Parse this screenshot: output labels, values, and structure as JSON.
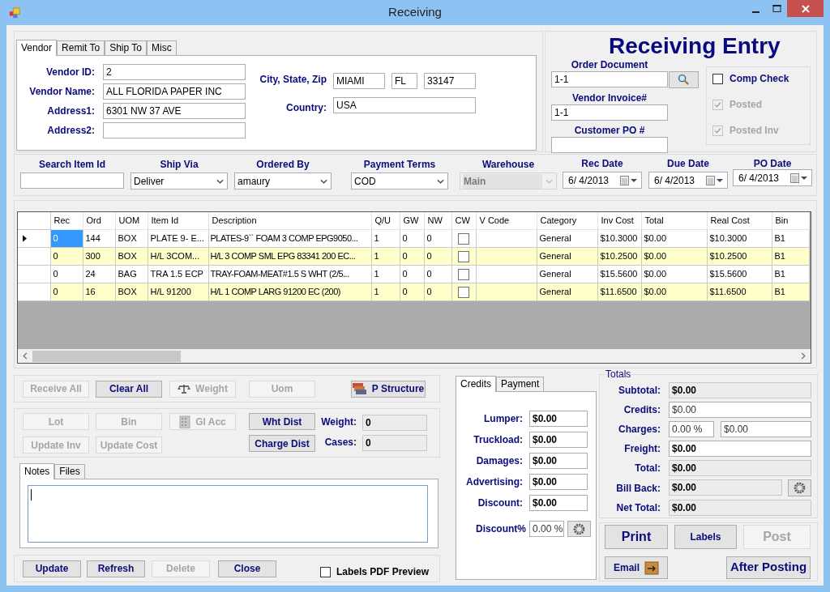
{
  "window": {
    "title": "Receiving"
  },
  "vendor_tabs": [
    {
      "label": "Vendor",
      "selected": true
    },
    {
      "label": "Remit To",
      "selected": false
    },
    {
      "label": "Ship To",
      "selected": false
    },
    {
      "label": "Misc",
      "selected": false
    }
  ],
  "vendor_fields": [
    {
      "label": "Vendor ID:",
      "value": "2"
    },
    {
      "label": "Vendor Name:",
      "value": "ALL FLORIDA PAPER INC"
    },
    {
      "label": "Address1:",
      "value": "6301 NW 37 AVE"
    },
    {
      "label": "Address2:"
    }
  ],
  "city_state_zip": {
    "label": "City, State, Zip",
    "city": "MIAMI",
    "state": "FL",
    "zip": "33147"
  },
  "country": {
    "label": "Country:",
    "value": "USA"
  },
  "entry": {
    "heading": "Receiving Entry",
    "fields": [
      {
        "label": "Order Document",
        "value": "1-1",
        "search": true
      },
      {
        "label": "Vendor Invoice#",
        "value": "1-1",
        "search": false
      },
      {
        "label": "Customer PO #",
        "search": false
      }
    ]
  },
  "flags": [
    {
      "label": "Comp Check",
      "checked": false,
      "disabled": false
    },
    {
      "label": "Posted",
      "checked": true,
      "disabled": true
    },
    {
      "label": "Posted Inv",
      "checked": true,
      "disabled": true
    }
  ],
  "filters": [
    {
      "label": "Search Item Id",
      "kind": "text"
    },
    {
      "label": "Ship Via",
      "kind": "dropdown",
      "value": "Deliver",
      "disabled": false
    },
    {
      "label": "Ordered By",
      "kind": "dropdown",
      "value": "amaury",
      "disabled": false
    },
    {
      "label": "Payment Terms",
      "kind": "dropdown",
      "value": "COD",
      "disabled": false
    },
    {
      "label": "Warehouse",
      "kind": "dropdown",
      "value": "Main",
      "disabled": true
    },
    {
      "label": "Rec Date",
      "kind": "date",
      "value": "6/ 4/2013"
    },
    {
      "label": "Due Date",
      "kind": "date",
      "value": "6/ 4/2013"
    },
    {
      "label": "PO Date",
      "kind": "date",
      "value": "6/ 4/2013"
    }
  ],
  "table": {
    "columns": [
      "Rec",
      "Ord",
      "UOM",
      "Item Id",
      "Description",
      "Q/U",
      "GW",
      "NW",
      "CW",
      "V Code",
      "Category",
      "Inv Cost",
      "Total",
      "Real Cost",
      "Bin"
    ],
    "rows": [
      {
        "selected": true,
        "cw": false,
        "cells": [
          "0",
          "144",
          "BOX",
          "PLATE 9- E...",
          "PLATES-9`` FOAM 3 COMP EPG9050...",
          "1",
          "0",
          "0",
          "",
          "",
          "General",
          "$10.3000",
          "$0.00",
          "$10.3000",
          "B1"
        ]
      },
      {
        "selected": false,
        "cw": false,
        "cells": [
          "0",
          "300",
          "BOX",
          "H/L 3COM...",
          "H/L 3 COMP SML EPG 83341 200 EC...",
          "1",
          "0",
          "0",
          "",
          "",
          "General",
          "$10.2500",
          "$0.00",
          "$10.2500",
          "B1"
        ]
      },
      {
        "selected": false,
        "cw": false,
        "cells": [
          "0",
          "24",
          "BAG",
          "TRA 1.5 ECP",
          "TRAY-FOAM-MEAT#1.5 S WHT (2/5...",
          "1",
          "0",
          "0",
          "",
          "",
          "General",
          "$15.5600",
          "$0.00",
          "$15.5600",
          "B1"
        ]
      },
      {
        "selected": false,
        "cw": false,
        "cells": [
          "0",
          "16",
          "BOX",
          "H/L 91200",
          "H/L 1 COMP LARG 91200 EC (200)",
          "1",
          "0",
          "0",
          "",
          "",
          "General",
          "$11.6500",
          "$0.00",
          "$11.6500",
          "B1"
        ]
      }
    ]
  },
  "tools_row1": [
    {
      "label": "Receive All",
      "disabled": true
    },
    {
      "label": "Clear All",
      "disabled": false
    },
    {
      "label": "Weight",
      "disabled": true,
      "kind": "scale"
    },
    {
      "label": "Uom",
      "disabled": true
    },
    {
      "label": "P Structure",
      "disabled": false,
      "kind": "stack"
    }
  ],
  "tools_row2": [
    {
      "label": "Lot",
      "disabled": true
    },
    {
      "label": "Bin",
      "disabled": true
    },
    {
      "label": "Gl Acc",
      "disabled": true,
      "kind": "building"
    },
    {
      "label": "Wht Dist",
      "disabled": false
    },
    {
      "label": "Update Inv",
      "disabled": true
    },
    {
      "label": "Update Cost",
      "disabled": true
    },
    {
      "label": "Charge Dist",
      "disabled": false
    }
  ],
  "measures": [
    {
      "label": "Weight:",
      "value": "0"
    },
    {
      "label": "Cases:",
      "value": "0"
    }
  ],
  "notes_tabs": [
    {
      "label": "Notes",
      "selected": true
    },
    {
      "label": "Files",
      "selected": false
    }
  ],
  "bottom_buttons": [
    {
      "label": "Update",
      "disabled": false
    },
    {
      "label": "Refresh",
      "disabled": false
    },
    {
      "label": "Delete",
      "disabled": true
    },
    {
      "label": "Close",
      "disabled": false
    }
  ],
  "labels_pdf_preview": {
    "label": "Labels PDF Preview",
    "checked": false
  },
  "credit_tabs": [
    {
      "label": "Credits",
      "selected": true
    },
    {
      "label": "Payment",
      "selected": false
    }
  ],
  "credits": [
    {
      "label": "Lumper:",
      "value": "$0.00"
    },
    {
      "label": "Truckload:",
      "value": "$0.00"
    },
    {
      "label": "Damages:",
      "value": "$0.00"
    },
    {
      "label": "Advertising:",
      "value": "$0.00"
    },
    {
      "label": "Discount:",
      "value": "$0.00"
    }
  ],
  "discount_percent": {
    "label": "Discount%",
    "value": "0.00 %"
  },
  "totals": {
    "title": "Totals",
    "rows": [
      {
        "label": "Subtotal:",
        "kind": "readonly",
        "value": "$0.00"
      },
      {
        "label": "Credits:",
        "kind": "input",
        "value": "$0.00"
      },
      {
        "label": "Charges:",
        "kind": "split",
        "percent": "0.00 %",
        "value": "$0.00"
      },
      {
        "label": "Freight:",
        "kind": "input_bold",
        "value": "$0.00"
      },
      {
        "label": "Total:",
        "kind": "readonly",
        "value": "$0.00"
      },
      {
        "label": "Bill Back:",
        "kind": "readonly_action",
        "value": "$0.00"
      },
      {
        "label": "Net Total:",
        "kind": "readonly",
        "value": "$0.00"
      }
    ]
  },
  "actions": [
    {
      "label": "Print",
      "disabled": false
    },
    {
      "label": "Labels",
      "disabled": false
    },
    {
      "label": "Post",
      "disabled": true
    },
    {
      "label": "Email",
      "disabled": false,
      "kind": "email"
    },
    {
      "label": "After Posting",
      "disabled": false
    }
  ]
}
